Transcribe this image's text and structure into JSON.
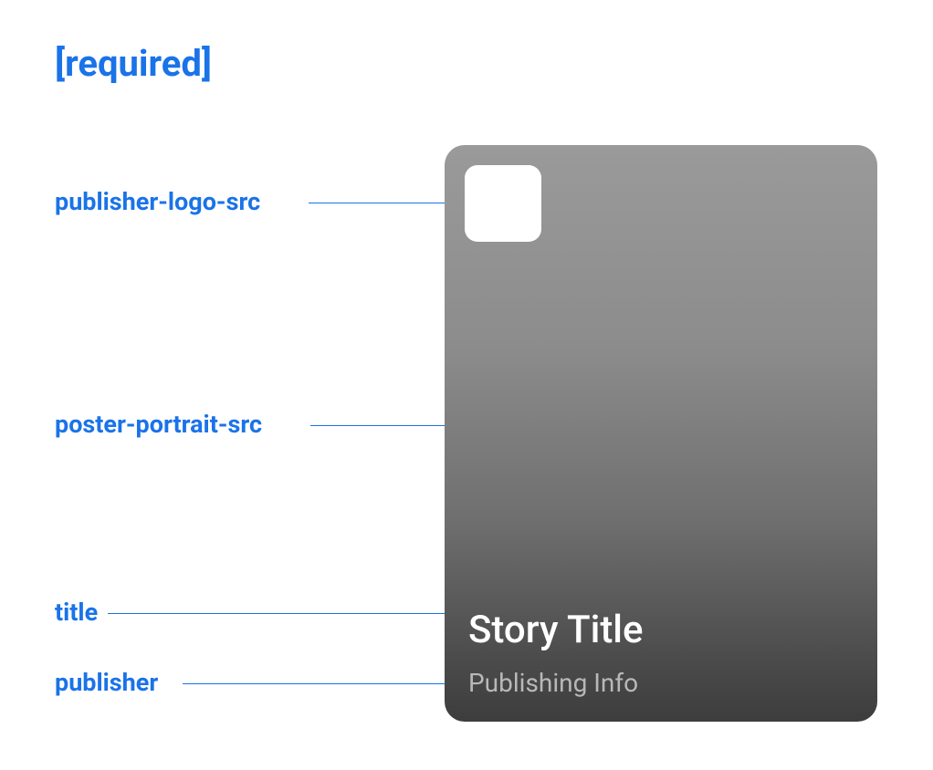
{
  "header": "[required]",
  "labels": {
    "publisher_logo_src": "publisher-logo-src",
    "poster_portrait_src": "poster-portrait-src",
    "title": "title",
    "publisher": "publisher"
  },
  "card": {
    "title": "Story Title",
    "publisher": "Publishing Info"
  }
}
